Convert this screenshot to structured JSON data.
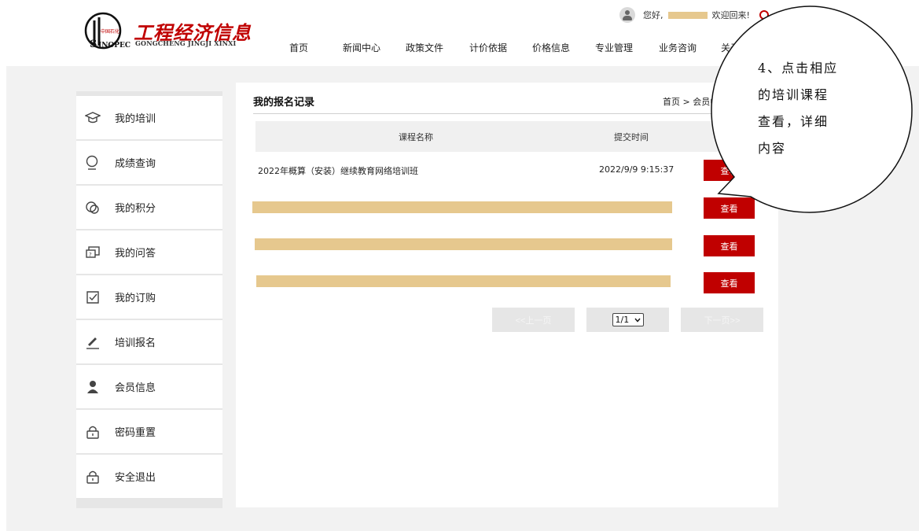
{
  "header": {
    "logo_cn": "工程经济信息",
    "logo_en": "GONGCHENG JINGJI XINXI",
    "greeting_prefix": "您好,",
    "greeting_suffix": "欢迎回来!",
    "nav": [
      "首页",
      "新闻中心",
      "政策文件",
      "计价依据",
      "价格信息",
      "专业管理",
      "业务咨询",
      "关于"
    ]
  },
  "sidebar": {
    "items": [
      {
        "label": "我的培训",
        "icon": "graduation-cap-icon"
      },
      {
        "label": "成绩查询",
        "icon": "search-icon"
      },
      {
        "label": "我的积分",
        "icon": "coins-icon"
      },
      {
        "label": "我的问答",
        "icon": "qa-icon"
      },
      {
        "label": "我的订购",
        "icon": "order-check-icon"
      },
      {
        "label": "培训报名",
        "icon": "pencil-icon"
      },
      {
        "label": "会员信息",
        "icon": "user-icon"
      },
      {
        "label": "密码重置",
        "icon": "lock-icon"
      },
      {
        "label": "安全退出",
        "icon": "lock-icon"
      }
    ]
  },
  "main": {
    "title": "我的报名记录",
    "breadcrumb": "首页 > 会员中",
    "columns": [
      "课程名称",
      "提交时间"
    ],
    "rows": [
      {
        "course": "2022年概算（安装）继续教育网络培训班",
        "time": "2022/9/9 9:15:37",
        "action": "查看"
      },
      {
        "course": "",
        "time": "",
        "action": "查看"
      },
      {
        "course": "",
        "time": "",
        "action": "查看"
      },
      {
        "course": "",
        "time": "",
        "action": "查看"
      }
    ],
    "pagination": {
      "prev": "<<上一页",
      "page": "1/1",
      "next": "下一页>>"
    }
  },
  "callout": {
    "lines": [
      "4、点击相应",
      "的培训课程",
      "查看，详细",
      "内容"
    ]
  },
  "colors": {
    "accent": "#c00000",
    "mask": "#e6c88e",
    "bg": "#f2f2f2"
  }
}
